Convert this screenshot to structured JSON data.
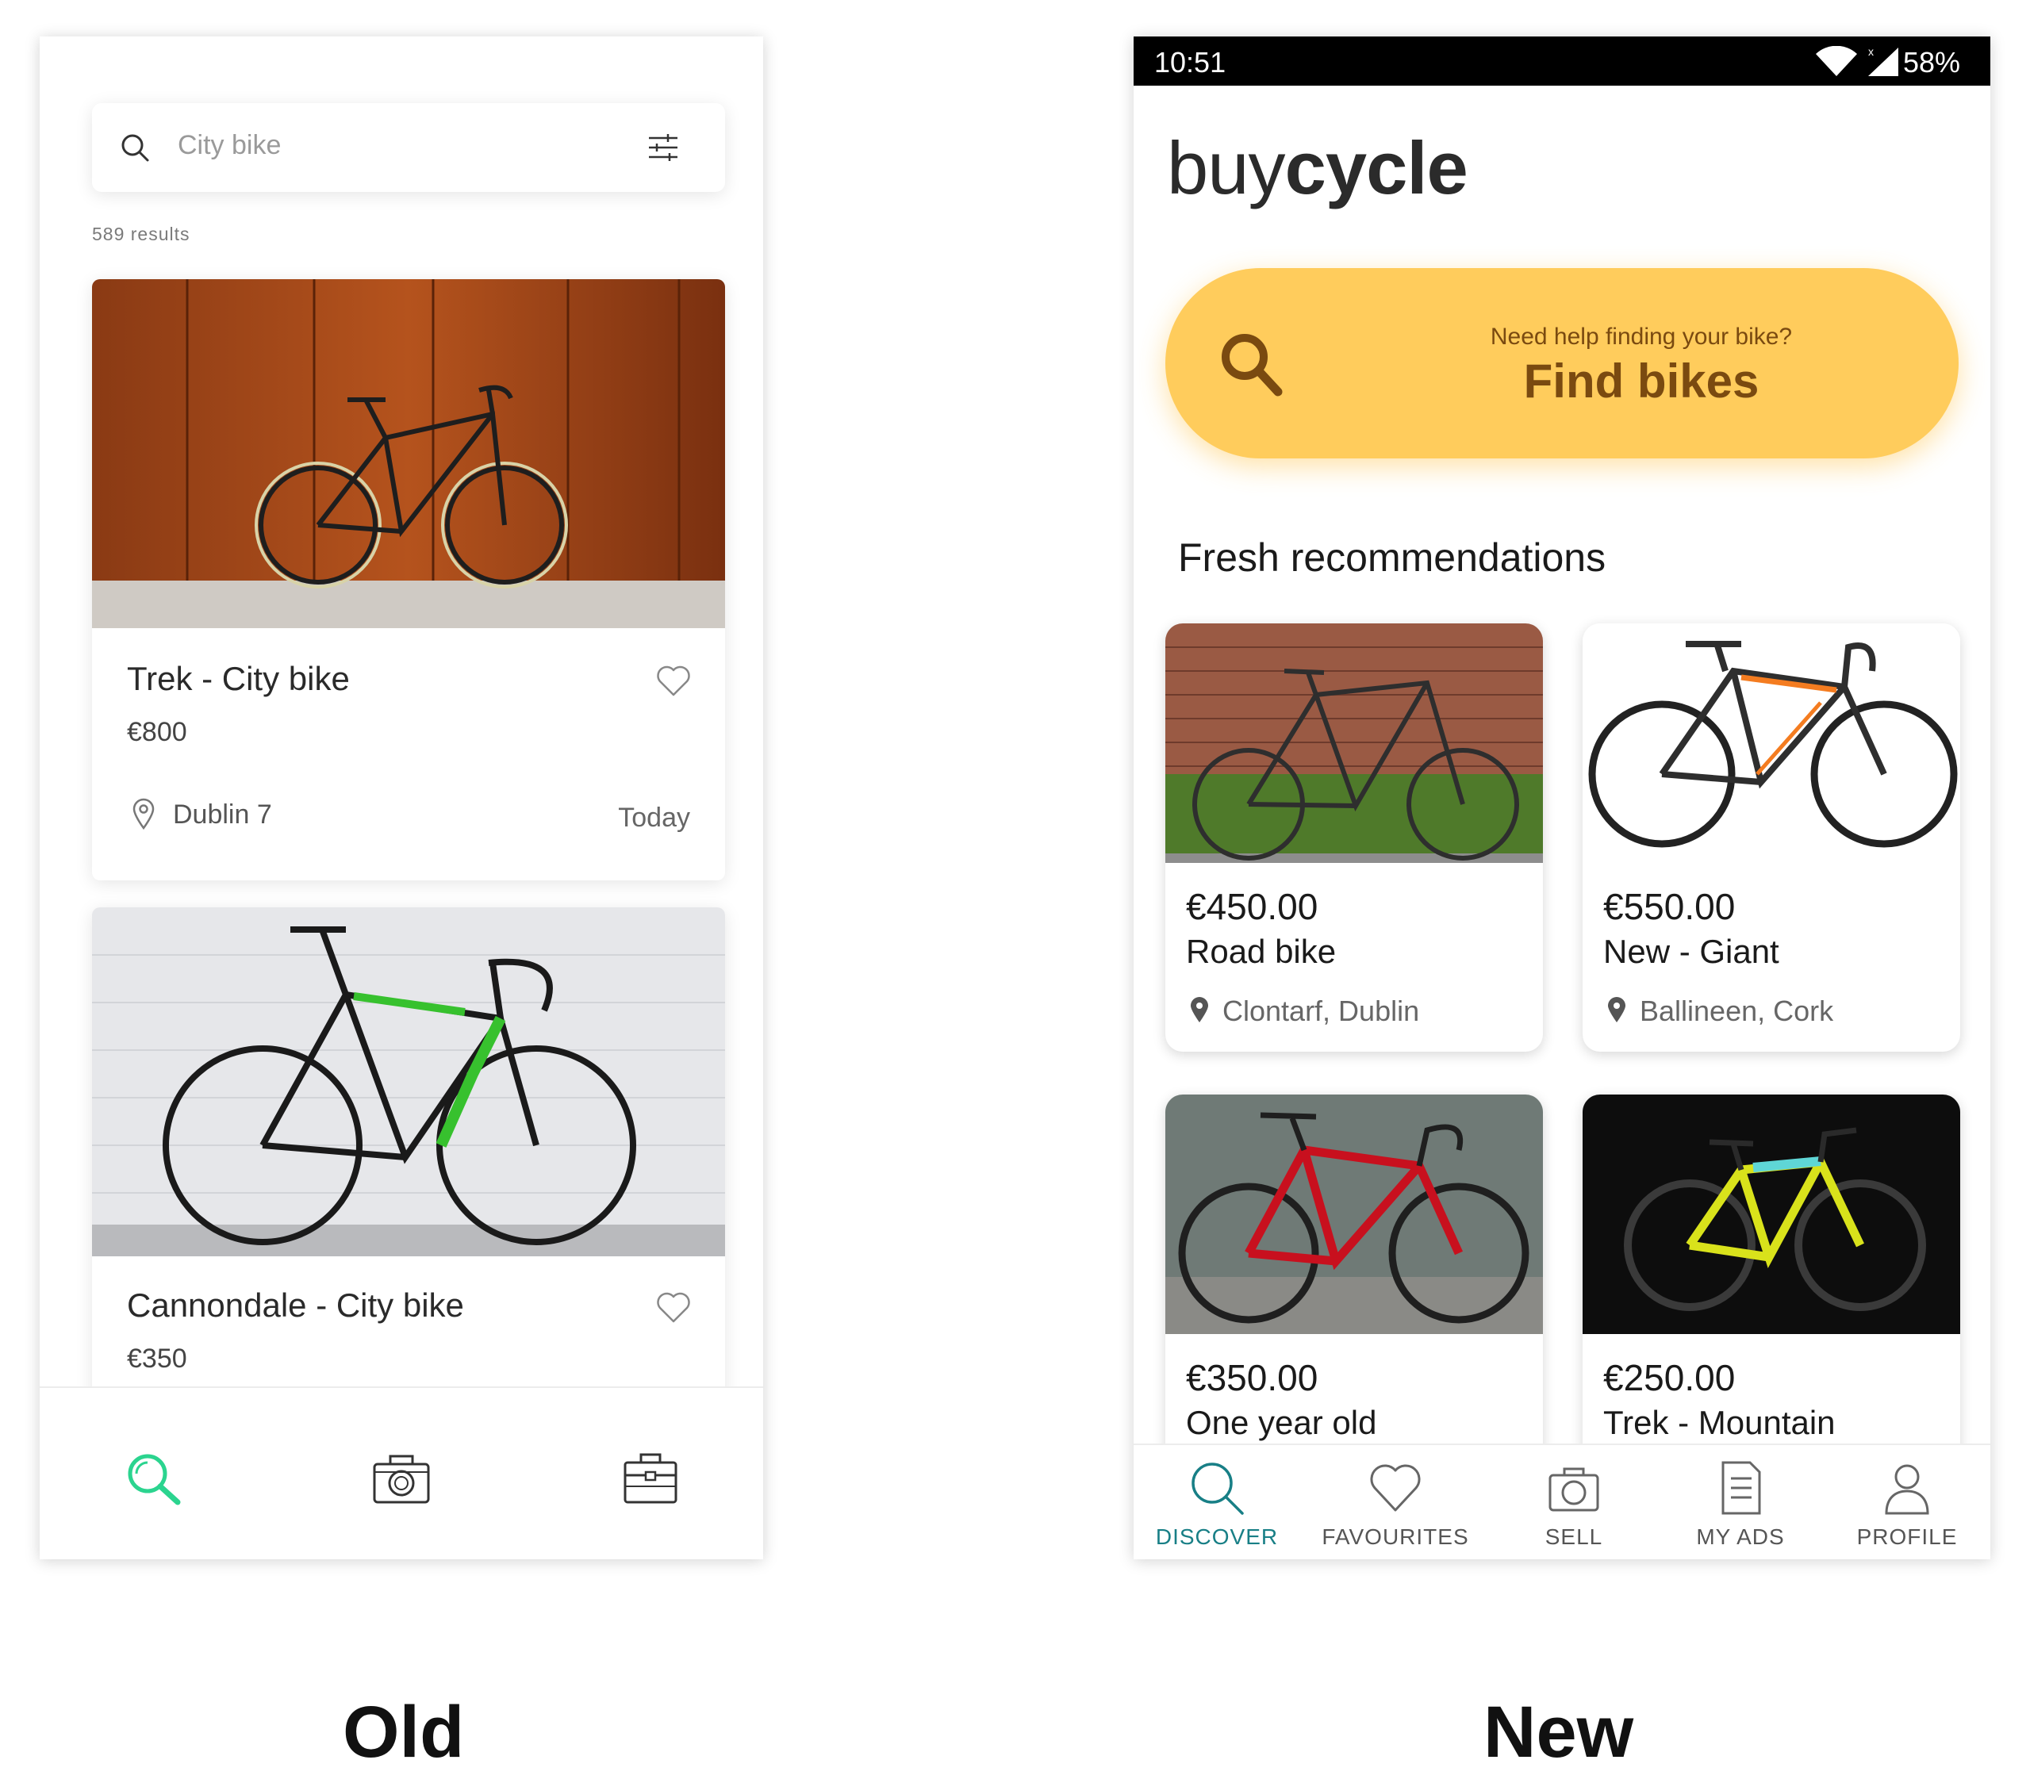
{
  "old": {
    "search": {
      "placeholder": "City bike"
    },
    "results_count": "589 results",
    "listings": [
      {
        "title": "Trek - City bike",
        "price": "€800",
        "location": "Dublin 7",
        "date": "Today"
      },
      {
        "title": "Cannondale - City bike",
        "price": "€350"
      }
    ],
    "nav": [
      "search-icon",
      "camera-icon",
      "toolbox-icon"
    ],
    "colors": {
      "accent": "#2bd48f"
    }
  },
  "new": {
    "status_bar": {
      "time": "10:51",
      "battery": "58%"
    },
    "logo": {
      "light": "buy",
      "bold": "cycle"
    },
    "cta": {
      "question": "Need help finding your bike?",
      "button": "Find bikes"
    },
    "section_title": "Fresh recommendations",
    "products": [
      {
        "price": "€450.00",
        "name": "Road bike",
        "location": "Clontarf, Dublin"
      },
      {
        "price": "€550.00",
        "name": "New - Giant",
        "location": "Ballineen, Cork"
      },
      {
        "price": "€350.00",
        "name": "One year old"
      },
      {
        "price": "€250.00",
        "name": "Trek - Mountain"
      }
    ],
    "bottom_nav": [
      {
        "label": "DISCOVER",
        "icon": "search-icon",
        "active": true
      },
      {
        "label": "FAVOURITES",
        "icon": "heart-icon"
      },
      {
        "label": "SELL",
        "icon": "camera-icon"
      },
      {
        "label": "MY ADS",
        "icon": "list-document-icon"
      },
      {
        "label": "PROFILE",
        "icon": "person-icon"
      }
    ],
    "colors": {
      "cta": "#ffcc5c",
      "cta_text": "#7a4a10",
      "active_nav": "#187f86"
    }
  },
  "captions": {
    "old": "Old",
    "new": "New"
  }
}
